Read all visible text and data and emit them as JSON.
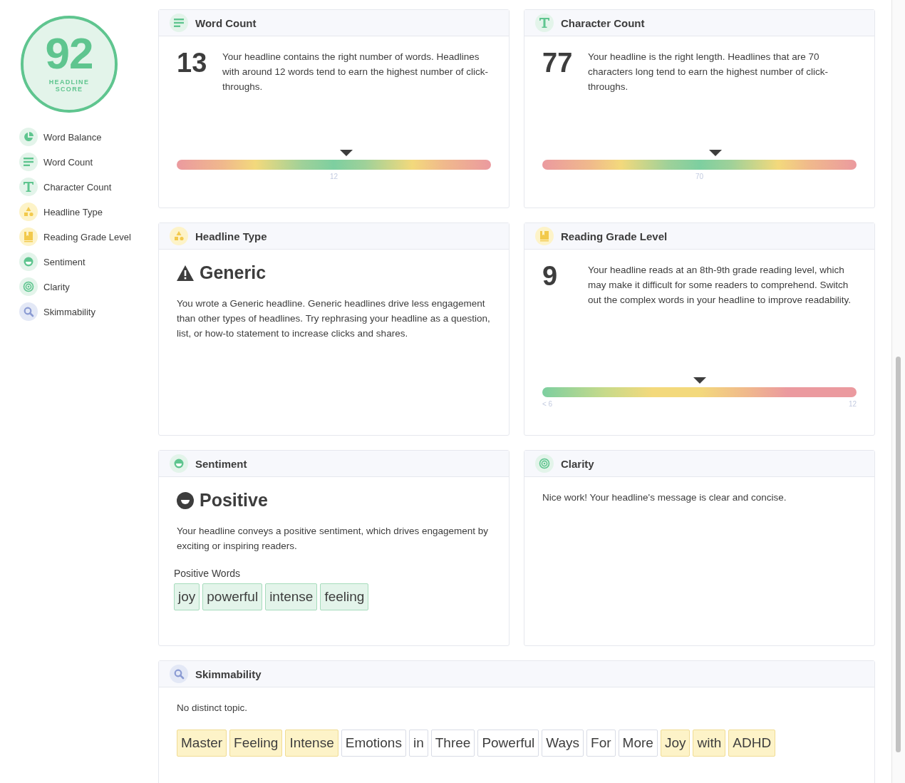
{
  "score": {
    "value": "92",
    "label": "HEADLINE SCORE"
  },
  "sidebar": {
    "items": [
      {
        "label": "Word Balance"
      },
      {
        "label": "Word Count"
      },
      {
        "label": "Character Count"
      },
      {
        "label": "Headline Type"
      },
      {
        "label": "Reading Grade Level"
      },
      {
        "label": "Sentiment"
      },
      {
        "label": "Clarity"
      },
      {
        "label": "Skimmability"
      }
    ]
  },
  "cards": [
    {
      "kind": "meter",
      "title": "Word Count",
      "value": "13",
      "text": "Your headline contains the right number of words. Headlines with around 12 words tend to earn the highest number of click-throughs.",
      "level": 0.54,
      "scale_labels": [
        "12"
      ]
    },
    {
      "kind": "meter",
      "title": "Character Count",
      "value": "77",
      "text": "Your headline is the right length. Headlines that are 70 characters long tend to earn the highest number of click-throughs.",
      "level": 0.55,
      "scale_labels": [
        "70"
      ]
    },
    {
      "kind": "verdict",
      "title": "Headline Type",
      "verdict": "Generic",
      "text": "You wrote a Generic headline. Generic headlines drive less engagement than other types of headlines. Try rephrasing your headline as a question, list, or how-to statement to increase clicks and shares."
    },
    {
      "kind": "rising_meter",
      "title": "Reading Grade Level",
      "value": "9",
      "text": "Your headline reads at an 8th-9th grade reading level, which may make it difficult for some readers to comprehend. Switch out the complex words in your headline to improve readability.",
      "level": 0.5,
      "scale_labels": [
        "< 6",
        "12"
      ]
    },
    {
      "kind": "verdict",
      "title": "Sentiment",
      "verdict": "Positive",
      "text": "Your headline conveys a positive sentiment, which drives engagement by exciting or inspiring readers.",
      "words_title": "Positive Words",
      "words": [
        "joy",
        "powerful",
        "intense",
        "feeling"
      ]
    },
    {
      "kind": "note",
      "title": "Clarity",
      "text": "Nice work! Your headline's message is clear and concise."
    },
    {
      "kind": "skim",
      "title": "Skimmability",
      "text": "No distinct topic.",
      "words": [
        {
          "word": "Master",
          "highlighted": true
        },
        {
          "word": "Feeling",
          "highlighted": true
        },
        {
          "word": "Intense",
          "highlighted": true
        },
        {
          "word": "Emotions",
          "highlighted": false
        },
        {
          "word": "in",
          "highlighted": false
        },
        {
          "word": "Three",
          "highlighted": false
        },
        {
          "word": "Powerful",
          "highlighted": false
        },
        {
          "word": "Ways",
          "highlighted": false
        },
        {
          "word": "For",
          "highlighted": false
        },
        {
          "word": "More",
          "highlighted": false
        },
        {
          "word": "Joy",
          "highlighted": true
        },
        {
          "word": "with",
          "highlighted": true
        },
        {
          "word": "ADHD",
          "highlighted": true
        }
      ]
    }
  ]
}
